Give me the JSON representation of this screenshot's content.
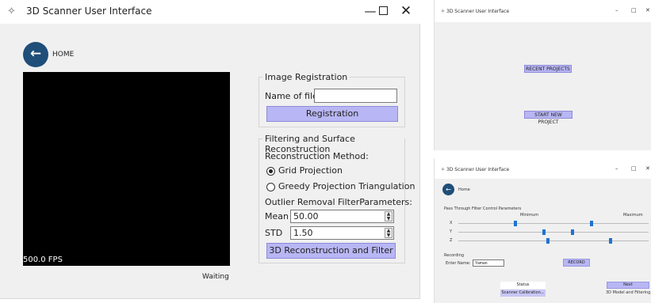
{
  "main_window": {
    "title": "3D Scanner User Interface",
    "controls": {
      "minimize": "—",
      "close": "✕"
    },
    "home_label": "HOME",
    "fps": "500.0 FPS",
    "status": "Waiting",
    "image_registration": {
      "title": "Image Registration",
      "name_label": "Name of file",
      "name_value": "",
      "button": "Registration"
    },
    "filtering": {
      "title": "Filtering and Surface Reconstruction",
      "method_label": "Reconstruction Method:",
      "options": [
        "Grid Projection",
        "Greedy Projection Triangulation"
      ],
      "selected_index": 0,
      "outlier_label": "Outlier Removal FilterParameters:",
      "mean_label": "Mean",
      "mean_value": "50.00",
      "std_label": "STD",
      "std_value": "1.50",
      "button": "3D Reconstruction and Filter"
    }
  },
  "start_window": {
    "title": "3D Scanner User Interface",
    "recent_button": "RECENT    PROJECTS",
    "new_button": "START NEW PROJECT"
  },
  "calib_window": {
    "title": "3D Scanner User Interface",
    "home_label": "Home",
    "filter_section": "Pass Through Filter Control Parameters",
    "minimum_label": "Minimum",
    "maximum_label": "Maximum",
    "axes": [
      "X",
      "Y",
      "Z"
    ],
    "sliders": {
      "minimum": [
        0.3,
        0.45,
        0.47
      ],
      "maximum": [
        0.7,
        0.6,
        0.8
      ]
    },
    "recording_label": "Recording",
    "enter_name_label": "Enter Name:",
    "name_value": "Yaman",
    "record_button": "RECORD",
    "status_label": "Status",
    "status_value": "Scanner Calibration...",
    "next_button": "Next",
    "next_subtext": "3D Model and Filtering"
  },
  "colors": {
    "accent_button": "#b8b6f4",
    "home_circle": "#1f4e79",
    "slider_thumb": "#1e73d2"
  },
  "icons": [
    "app-icon",
    "minimize-icon",
    "maximize-icon",
    "close-icon",
    "back-arrow-icon",
    "spin-arrows-icon"
  ]
}
